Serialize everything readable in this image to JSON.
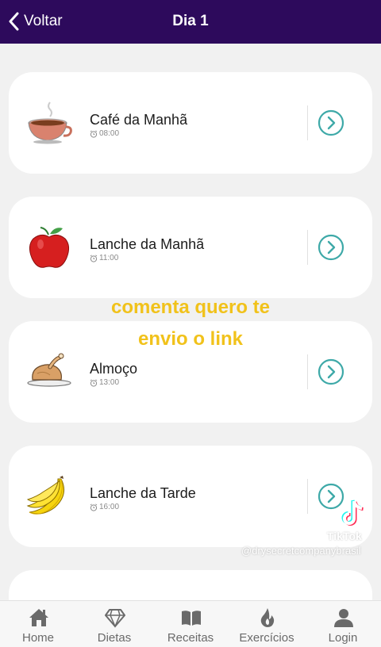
{
  "header": {
    "back_label": "Voltar",
    "title": "Dia 1",
    "background": "#2d0a5c"
  },
  "meals": [
    {
      "name": "Café da Manhã",
      "time": "08:00",
      "icon": "coffee-cup-icon"
    },
    {
      "name": "Lanche da Manhã",
      "time": "11:00",
      "icon": "apple-icon"
    },
    {
      "name": "Almoço",
      "time": "13:00",
      "icon": "roast-chicken-icon"
    },
    {
      "name": "Lanche da Tarde",
      "time": "16:00",
      "icon": "bananas-icon"
    }
  ],
  "overlay": {
    "line1": "comenta quero te",
    "line2": "envio o link",
    "color": "#f1c21b"
  },
  "watermark": {
    "label": "TikTok",
    "handle": "@drysecretcompanybrasil"
  },
  "tabs": [
    {
      "label": "Home",
      "icon": "home-icon"
    },
    {
      "label": "Dietas",
      "icon": "diamond-icon"
    },
    {
      "label": "Receitas",
      "icon": "book-icon"
    },
    {
      "label": "Exercícios",
      "icon": "flame-icon"
    },
    {
      "label": "Login",
      "icon": "user-icon"
    }
  ],
  "accent": "#3ea9a8"
}
